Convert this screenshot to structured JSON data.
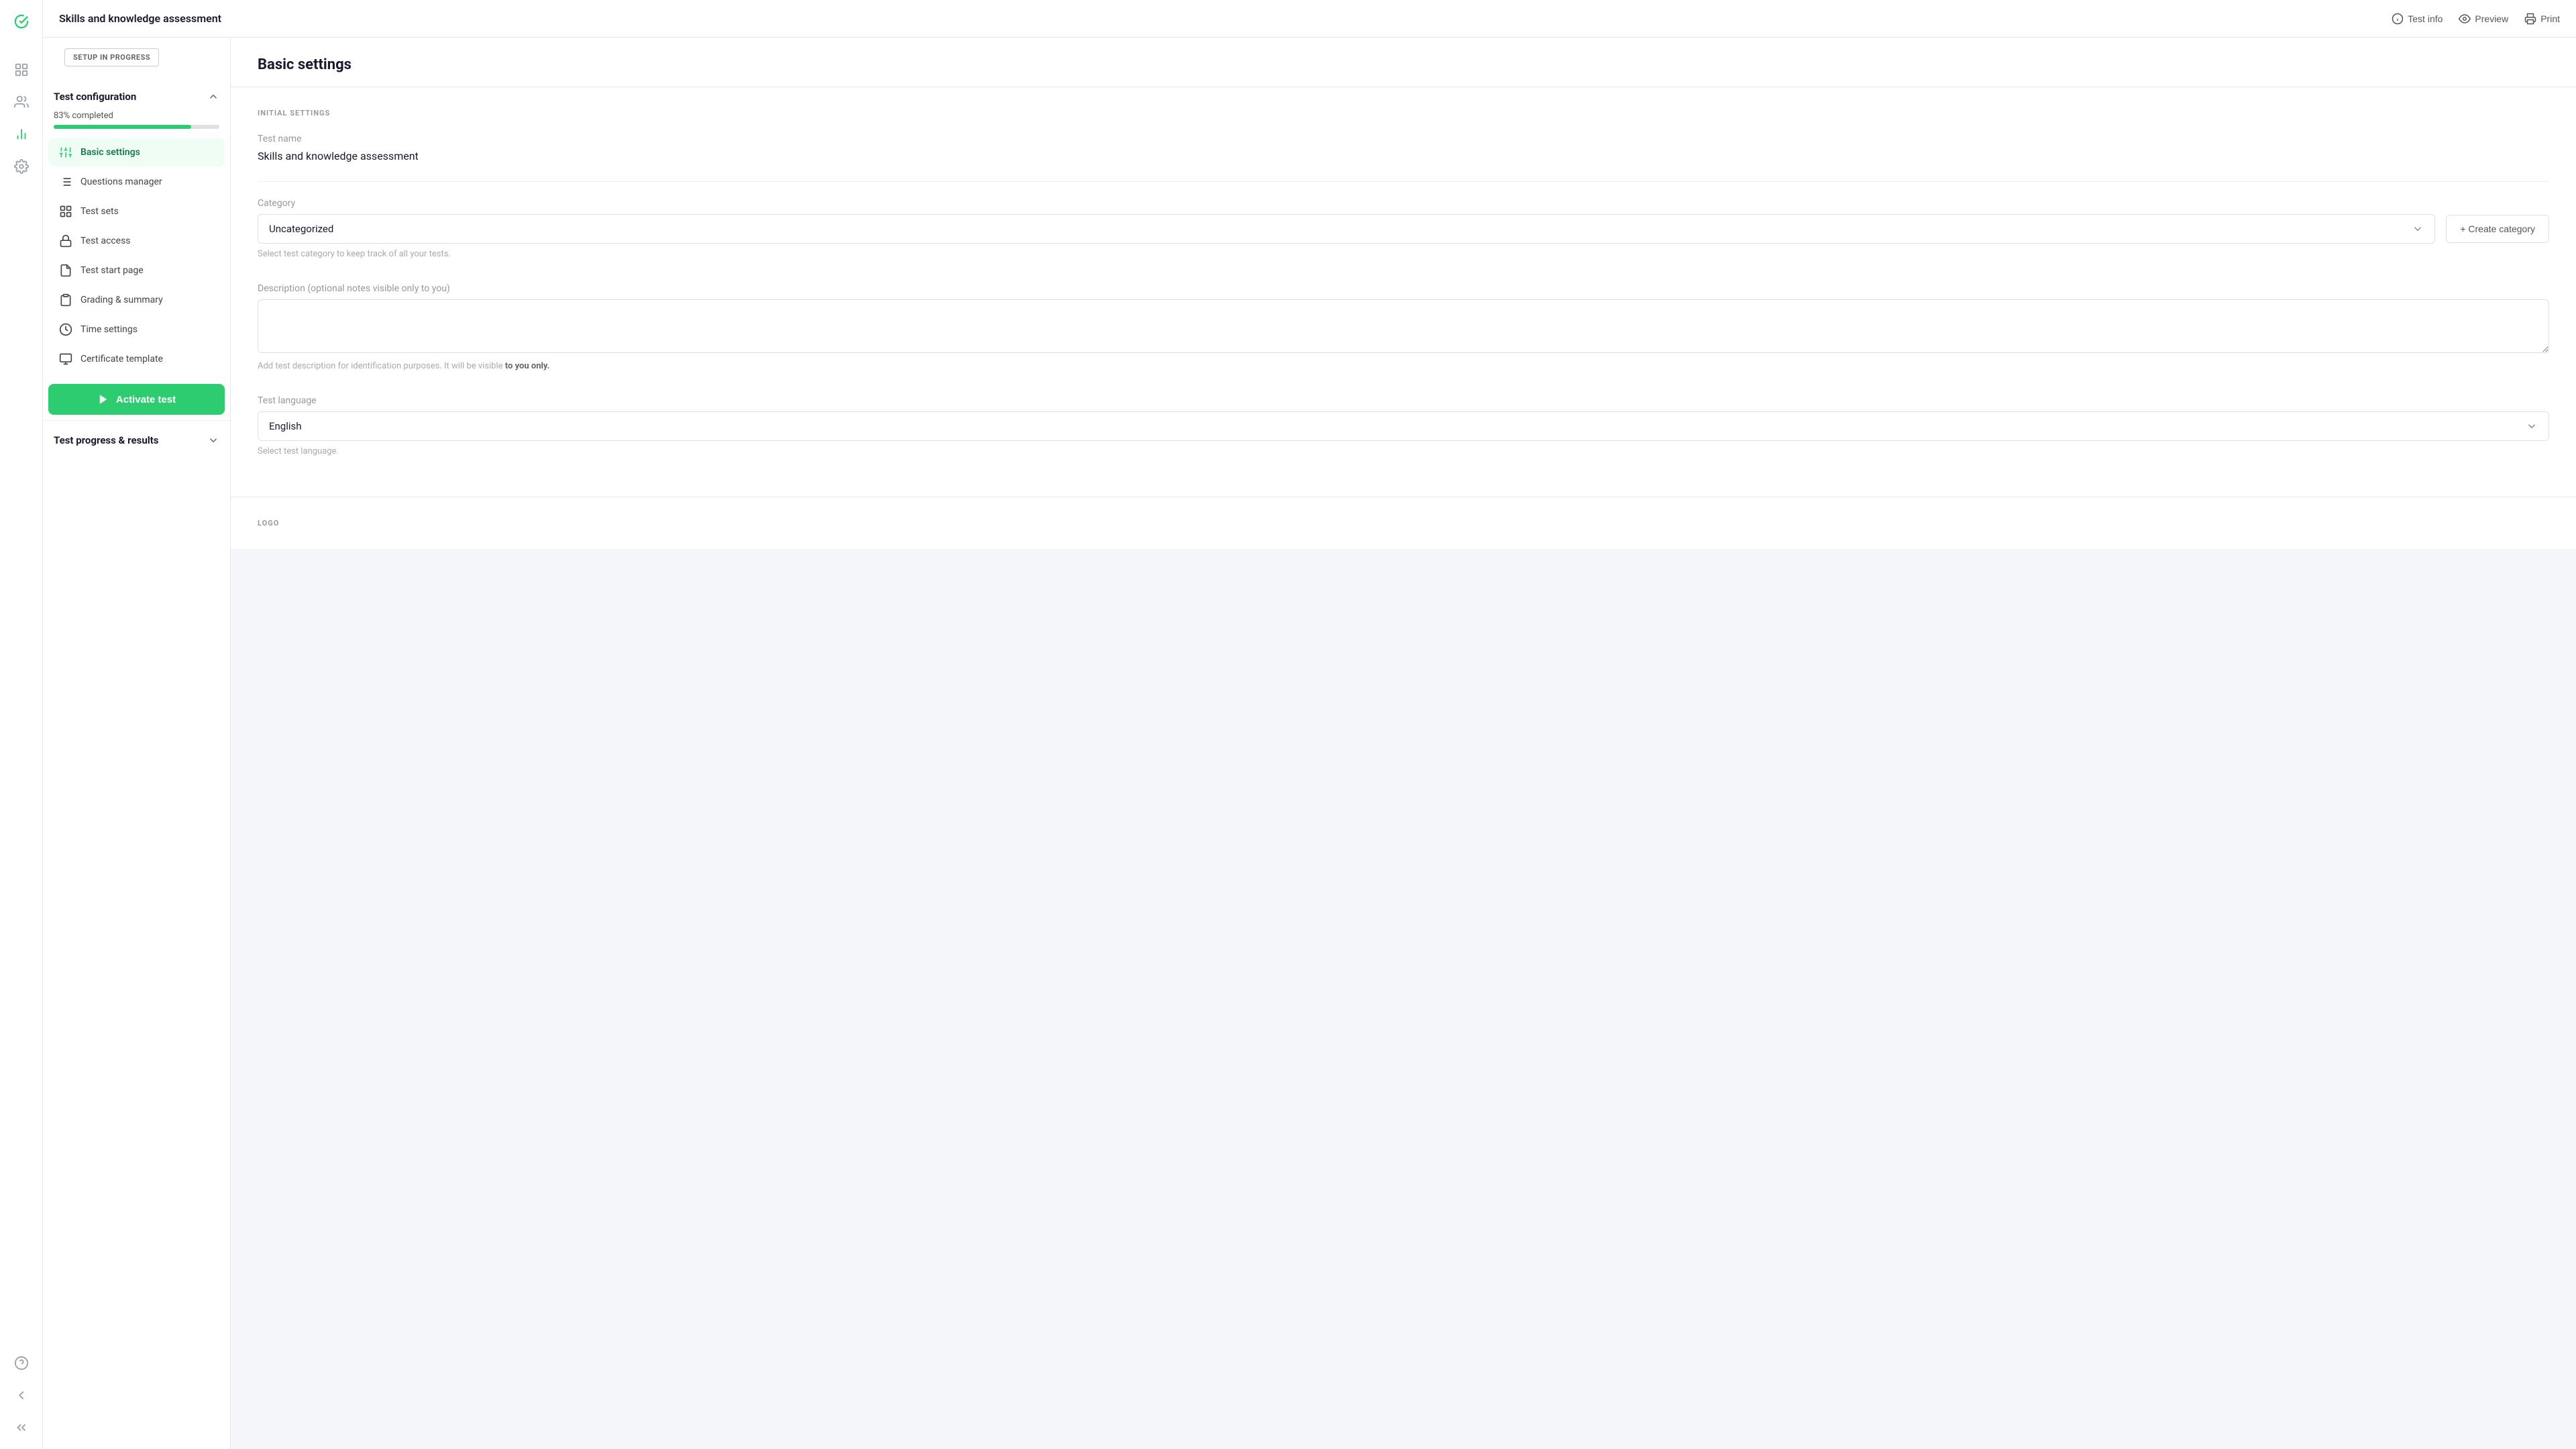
{
  "app": {
    "logo_icon": "check-circle-icon"
  },
  "header": {
    "page_title": "Skills and knowledge assessment",
    "actions": [
      {
        "id": "test-info",
        "label": "Test info",
        "icon": "info-icon"
      },
      {
        "id": "preview",
        "label": "Preview",
        "icon": "eye-icon"
      },
      {
        "id": "print",
        "label": "Print",
        "icon": "printer-icon"
      }
    ]
  },
  "left_nav": {
    "icons": [
      {
        "id": "dashboard",
        "icon": "grid-icon",
        "active": false
      },
      {
        "id": "users",
        "icon": "users-icon",
        "active": false
      },
      {
        "id": "tests",
        "icon": "bar-chart-icon",
        "active": true
      },
      {
        "id": "settings",
        "icon": "gear-icon",
        "active": false
      }
    ],
    "bottom_icons": [
      {
        "id": "help",
        "icon": "help-icon"
      },
      {
        "id": "back",
        "icon": "back-icon"
      },
      {
        "id": "collapse",
        "icon": "collapse-icon"
      }
    ]
  },
  "sidebar": {
    "setup_badge": "SETUP IN PROGRESS",
    "config_section": {
      "title": "Test configuration",
      "progress_text": "83% completed",
      "progress_percent": 83,
      "items": [
        {
          "id": "basic-settings",
          "label": "Basic settings",
          "icon": "sliders-icon",
          "active": true
        },
        {
          "id": "questions-manager",
          "label": "Questions manager",
          "icon": "list-icon",
          "active": false
        },
        {
          "id": "test-sets",
          "label": "Test sets",
          "icon": "grid-small-icon",
          "active": false
        },
        {
          "id": "test-access",
          "label": "Test access",
          "icon": "lock-icon",
          "active": false
        },
        {
          "id": "test-start-page",
          "label": "Test start page",
          "icon": "file-icon",
          "active": false
        },
        {
          "id": "grading-summary",
          "label": "Grading & summary",
          "icon": "clipboard-icon",
          "active": false
        },
        {
          "id": "time-settings",
          "label": "Time settings",
          "icon": "clock-icon",
          "active": false
        },
        {
          "id": "certificate-template",
          "label": "Certificate template",
          "icon": "certificate-icon",
          "active": false
        }
      ],
      "activate_btn": "Activate test"
    },
    "results_section": {
      "title": "Test progress & results"
    }
  },
  "main": {
    "section_title": "Basic settings",
    "sub_section_label": "INITIAL SETTINGS",
    "fields": {
      "test_name_label": "Test name",
      "test_name_value": "Skills and knowledge assessment",
      "category_label": "Category",
      "category_value": "Uncategorized",
      "category_hint": "Select test category to keep track of all your tests.",
      "create_category_btn": "+ Create category",
      "description_label": "Description (optional notes visible only to you)",
      "description_placeholder": "",
      "description_hint_prefix": "Add test description for identification purposes. It will be visible ",
      "description_hint_bold": "to you only.",
      "language_label": "Test language",
      "language_value": "English",
      "language_hint": "Select test language."
    },
    "logo_section_label": "LOGO"
  },
  "colors": {
    "green": "#2ecc71",
    "dark_green": "#27ae60",
    "text_dark": "#1a1a2e",
    "text_muted": "#999",
    "border": "#e0e0e0"
  }
}
